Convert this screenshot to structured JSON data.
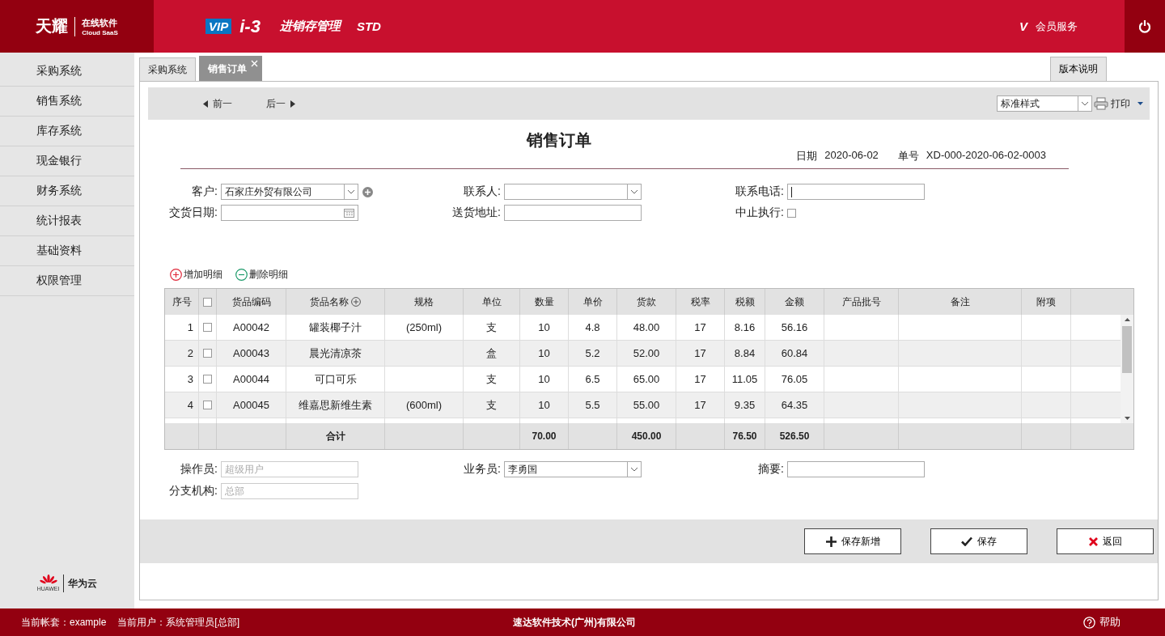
{
  "header": {
    "brand": "天耀",
    "brand_sub": "在线软件",
    "brand_sub_en": "Cloud SaaS",
    "vip": "VIP",
    "product": "i-3",
    "module": "进销存管理",
    "edition": "STD",
    "member_mark": "V",
    "member": "会员服务"
  },
  "sidebar": {
    "items": [
      {
        "label": "采购系统",
        "selected": false
      },
      {
        "label": "销售系统",
        "selected": false
      },
      {
        "label": "库存系统",
        "selected": false
      },
      {
        "label": "现金银行",
        "selected": false
      },
      {
        "label": "财务系统",
        "selected": false
      },
      {
        "label": "统计报表",
        "selected": false
      },
      {
        "label": "基础资料",
        "selected": false
      },
      {
        "label": "权限管理",
        "selected": false
      }
    ],
    "partner": "华为云",
    "partner_logo_text": "HUAWEI"
  },
  "tabs": [
    {
      "label": "采购系统",
      "selected": false,
      "closable": false
    },
    {
      "label": "销售订单",
      "selected": true,
      "closable": true
    }
  ],
  "version_button": "版本说明",
  "toolbar": {
    "prev": "前一",
    "next": "后一",
    "style_select": "标准样式",
    "print": "打印"
  },
  "form": {
    "title": "销售订单",
    "date_label": "日期",
    "date": "2020-06-02",
    "number_label": "单号",
    "number": "XD-000-2020-06-02-0003",
    "fields": [
      {
        "label": "客户:",
        "kind": "select",
        "value": "石家庄外贸有限公司",
        "add_button": true
      },
      {
        "label": "联系人:",
        "kind": "select"
      },
      {
        "label": "联系电话:",
        "kind": "input",
        "focused": true
      },
      {
        "label": "交货日期:",
        "kind": "date"
      },
      {
        "label": "送货地址:",
        "kind": "input"
      },
      {
        "label": "中止执行:",
        "kind": "checkbox",
        "checked": false
      }
    ]
  },
  "detail_actions": [
    {
      "label": "增加明细",
      "kind": "add"
    },
    {
      "label": "删除明细",
      "kind": "remove"
    }
  ],
  "table": {
    "select_all_checked": false,
    "columns": [
      {
        "label": "序号",
        "kind": "number"
      },
      {
        "kind": "check"
      },
      {
        "label": "货品编码"
      },
      {
        "label": "货品名称",
        "add_icon": true,
        "total": "合计"
      },
      {
        "label": "规格"
      },
      {
        "label": "单位"
      },
      {
        "label": "数量",
        "total": "70.00"
      },
      {
        "label": "单价"
      },
      {
        "label": "货款",
        "total": "450.00"
      },
      {
        "label": "税率"
      },
      {
        "label": "税额",
        "total": "76.50"
      },
      {
        "label": "金额",
        "total": "526.50"
      },
      {
        "label": "产品批号"
      },
      {
        "label": "备注"
      },
      {
        "label": "附项"
      }
    ],
    "rows": [
      {
        "checked": false,
        "cells": [
          "1",
          null,
          "A00042",
          "罐装椰子汁",
          "(250ml)",
          "支",
          "10",
          "4.8",
          "48.00",
          "17",
          "8.16",
          "56.16"
        ]
      },
      {
        "checked": false,
        "cells": [
          "2",
          null,
          "A00043",
          "晨光清凉茶",
          null,
          "盒",
          "10",
          "5.2",
          "52.00",
          "17",
          "8.84",
          "60.84"
        ]
      },
      {
        "checked": false,
        "cells": [
          "3",
          null,
          "A00044",
          "可口可乐",
          null,
          "支",
          "10",
          "6.5",
          "65.00",
          "17",
          "11.05",
          "76.05"
        ]
      },
      {
        "checked": false,
        "cells": [
          "4",
          null,
          "A00045",
          "维嘉思新维生素",
          "(600ml)",
          "支",
          "10",
          "5.5",
          "55.00",
          "17",
          "9.35",
          "64.35"
        ]
      }
    ]
  },
  "footer_fields": [
    {
      "label": "操作员:",
      "kind": "input",
      "value": "超级用户",
      "disabled": true
    },
    {
      "label": "业务员:",
      "kind": "select",
      "value": "李勇国"
    },
    {
      "label": "摘要:",
      "kind": "input"
    },
    {
      "label": "分支机构:",
      "kind": "input",
      "value": "总部",
      "disabled": true
    }
  ],
  "buttons": [
    {
      "label": "保存新增",
      "kind": "add"
    },
    {
      "label": "保存",
      "kind": "save"
    },
    {
      "label": "返回",
      "kind": "back"
    }
  ],
  "status_bar": {
    "account": "当前帐套：example",
    "user": "当前用户：系统管理员[总部]",
    "company": "速达软件技术(广州)有限公司",
    "help": "帮助"
  }
}
